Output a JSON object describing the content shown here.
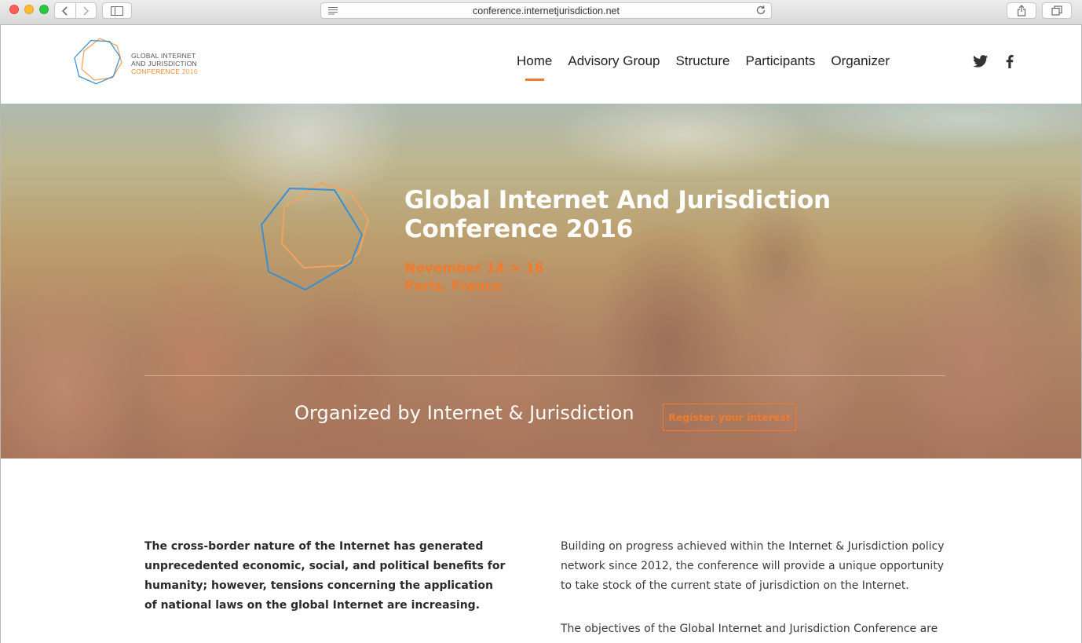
{
  "browser": {
    "url": "conference.internetjurisdiction.net"
  },
  "logo": {
    "line1": "GLOBAL INTERNET",
    "line2": "AND JURISDICTION",
    "line3": "CONFERENCE",
    "year": "2016",
    "colors": {
      "blue": "#3a8fd0",
      "orange": "#f2a35f"
    }
  },
  "nav": {
    "items": [
      {
        "label": "Home",
        "active": true
      },
      {
        "label": "Advisory Group"
      },
      {
        "label": "Structure"
      },
      {
        "label": "Participants"
      },
      {
        "label": "Organizer"
      }
    ],
    "accent": "#f07b2f"
  },
  "social": {
    "icons": [
      "twitter-icon",
      "facebook-icon"
    ]
  },
  "hero": {
    "title_line1": "Global Internet And Jurisdiction",
    "title_line2": "Conference 2016",
    "date": "November 14 > 16",
    "place": "Paris, France",
    "organized": "Organized by Internet & Jurisdiction",
    "cta": "Register your interest"
  },
  "intro": {
    "left": "The cross-border nature of the Internet has generated unprecedented economic, social, and political benefits for humanity; however, tensions concerning the application of national laws on the global Internet are increasing.",
    "right_p1": "Building on progress achieved within the Internet & Jurisdiction policy network since 2012, the conference will provide a unique opportunity to take stock of the current state of jurisdiction on the Internet.",
    "right_p2": "The objectives of the Global Internet and Jurisdiction Conference are"
  }
}
